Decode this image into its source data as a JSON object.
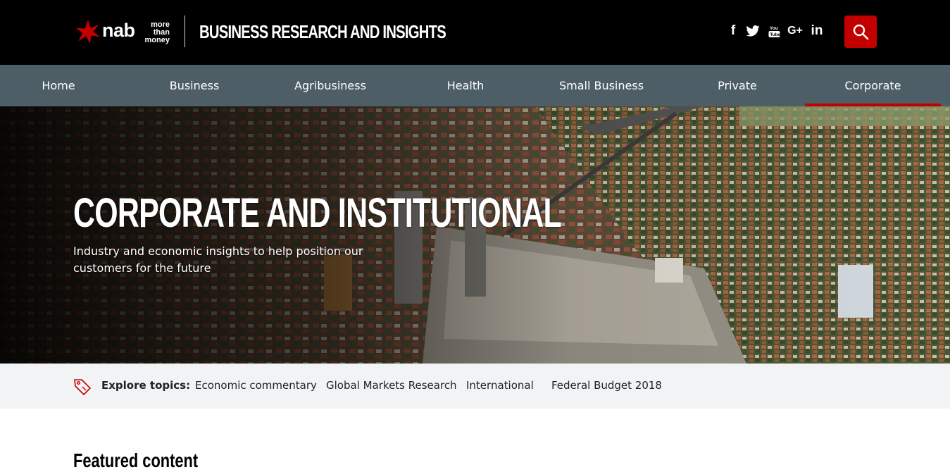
{
  "brand": {
    "logo_word": "nab",
    "tagline_lines": [
      "more",
      "than",
      "money"
    ],
    "site_title": "BUSINESS RESEARCH AND INSIGHTS",
    "accent_color": "#c20000"
  },
  "social": [
    {
      "name": "facebook-icon",
      "glyph": "f"
    },
    {
      "name": "twitter-icon",
      "glyph": ""
    },
    {
      "name": "youtube-icon",
      "glyph": ""
    },
    {
      "name": "google-plus-icon",
      "glyph": "G+"
    },
    {
      "name": "linkedin-icon",
      "glyph": "in"
    }
  ],
  "search": {
    "icon": "search-icon"
  },
  "nav": {
    "items": [
      {
        "label": "Home",
        "active": false
      },
      {
        "label": "Business",
        "active": false
      },
      {
        "label": "Agribusiness",
        "active": false
      },
      {
        "label": "Health",
        "active": false
      },
      {
        "label": "Small Business",
        "active": false
      },
      {
        "label": "Private",
        "active": false
      },
      {
        "label": "Corporate",
        "active": true
      }
    ]
  },
  "hero": {
    "title": "CORPORATE AND INSTITUTIONAL",
    "subtitle": "Industry and economic insights to help position our customers for the future"
  },
  "topics": {
    "label": "Explore topics:",
    "icon": "tag-icon",
    "links": [
      "Economic commentary",
      "Global Markets Research",
      "International",
      "Federal Budget 2018"
    ]
  },
  "featured": {
    "heading": "Featured content"
  }
}
